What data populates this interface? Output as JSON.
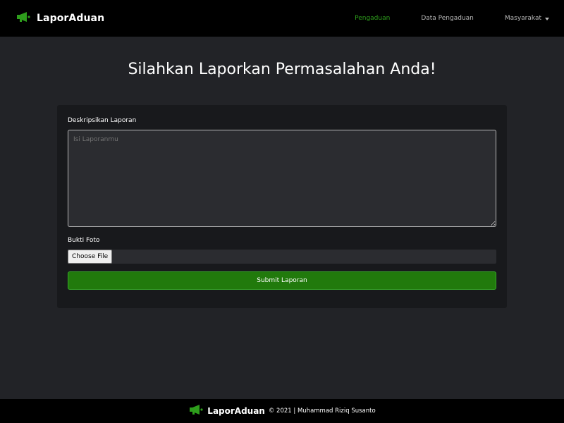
{
  "navbar": {
    "brand": "LaporAduan",
    "brand_icon": "megaphone-icon",
    "links": [
      "Pengaduan",
      "Data Pengaduan"
    ],
    "active_link": "Pengaduan",
    "dropdown_label": "Masyarakat"
  },
  "main": {
    "title": "Silahkan Laporkan Permasalahan Anda!",
    "form": {
      "description_label": "Deskripsikan Laporan",
      "description_placeholder": "Isi Laporanmu",
      "description_value": "",
      "photo_label": "Bukti Foto",
      "choose_file_label": "Choose File",
      "submit_label": "Submit Laporan"
    }
  },
  "footer": {
    "brand": "LaporAduan",
    "text": "© 2021 | Muhammad Riziq Susanto"
  },
  "colors": {
    "accent": "#2e9e1c",
    "submit_bg": "#217a0c",
    "navbar_bg": "#000000",
    "page_bg": "#222327",
    "card_bg": "#18191c"
  }
}
